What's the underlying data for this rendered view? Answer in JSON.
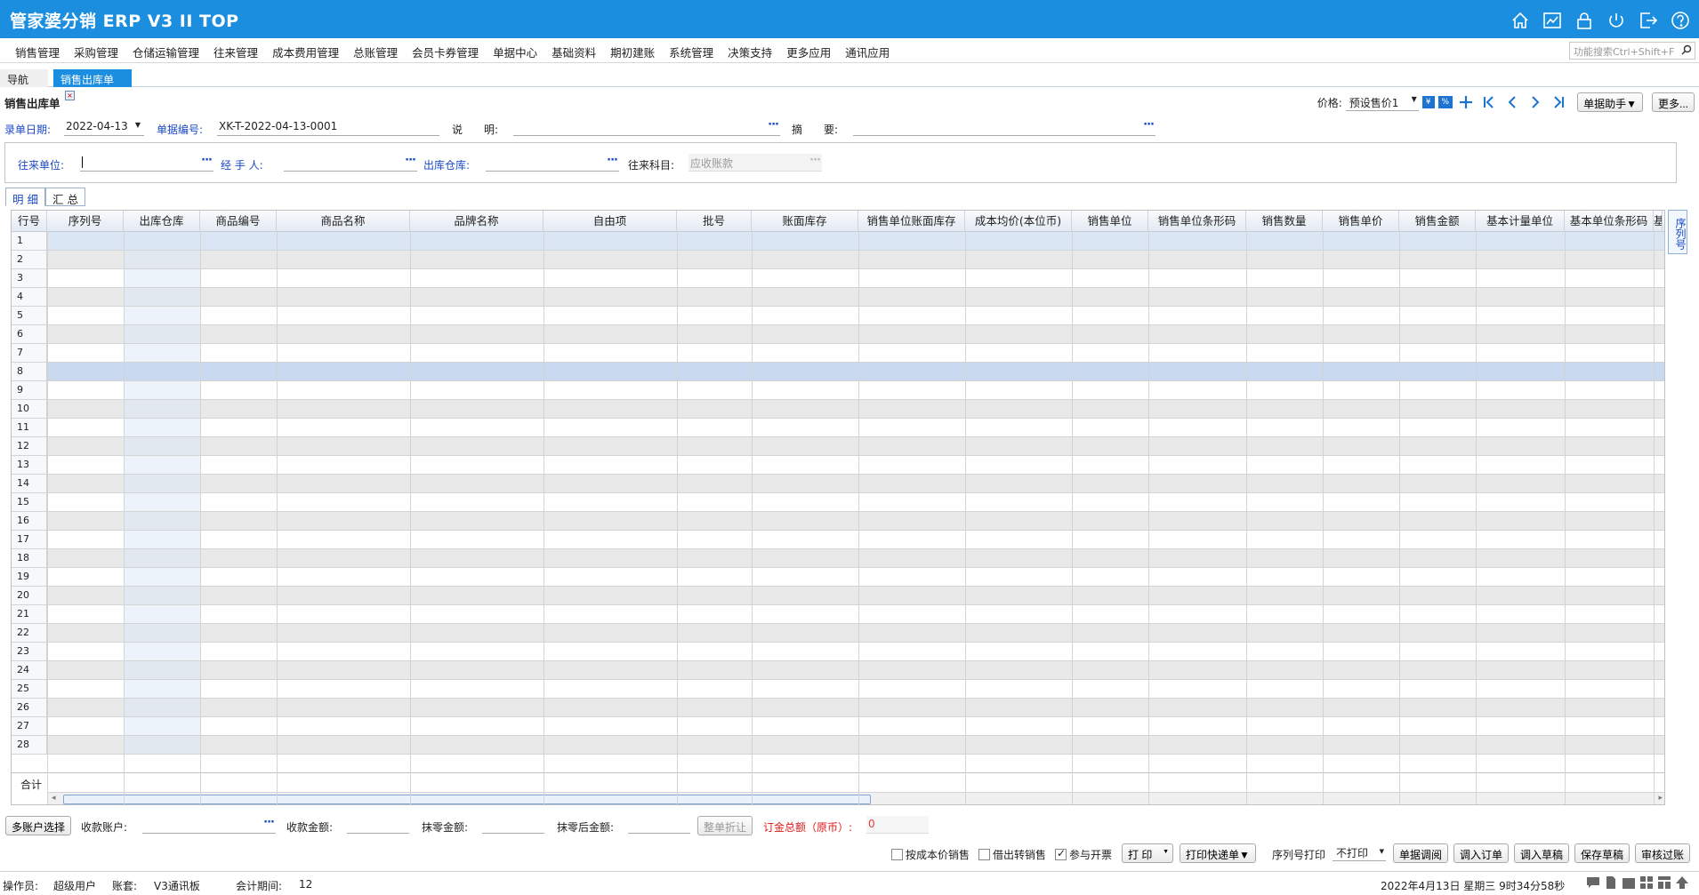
{
  "app": {
    "title": "管家婆分销 ERP V3 II TOP"
  },
  "menu": [
    "销售管理",
    "采购管理",
    "仓储运输管理",
    "往来管理",
    "成本费用管理",
    "总账管理",
    "会员卡券管理",
    "单据中心",
    "基础资料",
    "期初建账",
    "系统管理",
    "决策支持",
    "更多应用",
    "通讯应用"
  ],
  "search": {
    "placeholder": "功能搜索Ctrl+Shift+F"
  },
  "tabs": {
    "nav": "导航",
    "doc": "销售出库单"
  },
  "page": {
    "title": "销售出库单"
  },
  "price": {
    "label": "价格:",
    "value": "预设售价1",
    "badge1": "¥",
    "badge2": "%",
    "helper": "单据助手▼",
    "more": "更多..."
  },
  "form": {
    "date_label": "录单日期:",
    "date_value": "2022-04-13",
    "no_label": "单据编号:",
    "no_value": "XK-T-2022-04-13-0001",
    "desc_label": "说　　明:",
    "summary_label": "摘　　要:",
    "partner_label": "往来单位:",
    "handler_label": "经 手 人:",
    "warehouse_label": "出库仓库:",
    "subject_label": "往来科目:",
    "subject_value": "应收账款"
  },
  "subtabs": [
    "明 细",
    "汇 总"
  ],
  "grid": {
    "columns": [
      "行号",
      "序列号",
      "出库仓库",
      "商品编号",
      "商品名称",
      "品牌名称",
      "自由项",
      "批号",
      "账面库存",
      "销售单位账面库存",
      "成本均价(本位币)",
      "销售单位",
      "销售单位条形码",
      "销售数量",
      "销售单价",
      "销售金额",
      "基本计量单位",
      "基本单位条形码",
      "基"
    ],
    "rows": [
      "1",
      "2",
      "3",
      "4",
      "5",
      "6",
      "7",
      "8",
      "9",
      "10",
      "11",
      "12",
      "13",
      "14",
      "15",
      "16",
      "17",
      "18",
      "19",
      "20",
      "21",
      "22",
      "23",
      "24",
      "25",
      "26",
      "27",
      "28"
    ],
    "total_label": "合计"
  },
  "side_tab": "序列号",
  "footer": {
    "multi_account": "多账户选择",
    "account_label": "收款账户:",
    "amount_label": "收款金额:",
    "round_label": "抹零金额:",
    "after_round_label": "抹零后金额:",
    "discount_btn": "整单折让",
    "order_total_label": "订金总额（原币）:",
    "order_total_value": "0"
  },
  "actions": {
    "cost_sale": "按成本价销售",
    "borrow": "借出转销售",
    "invoice": "参与开票",
    "print": "打 印",
    "print_express": "打印快递单▼",
    "serial_print_label": "序列号打印",
    "serial_print_value": "不打印",
    "adjust": "单据调阅",
    "import_order": "调入订单",
    "import_draft": "调入草稿",
    "save_draft": "保存草稿",
    "audit": "审核过账"
  },
  "status": {
    "operator_label": "操作员:",
    "operator": "超级用户",
    "book_label": "账套:",
    "book": "V3通讯板",
    "period_label": "会计期间:",
    "period": "12",
    "datetime": "2022年4月13日  星期三  9时34分58秒"
  }
}
